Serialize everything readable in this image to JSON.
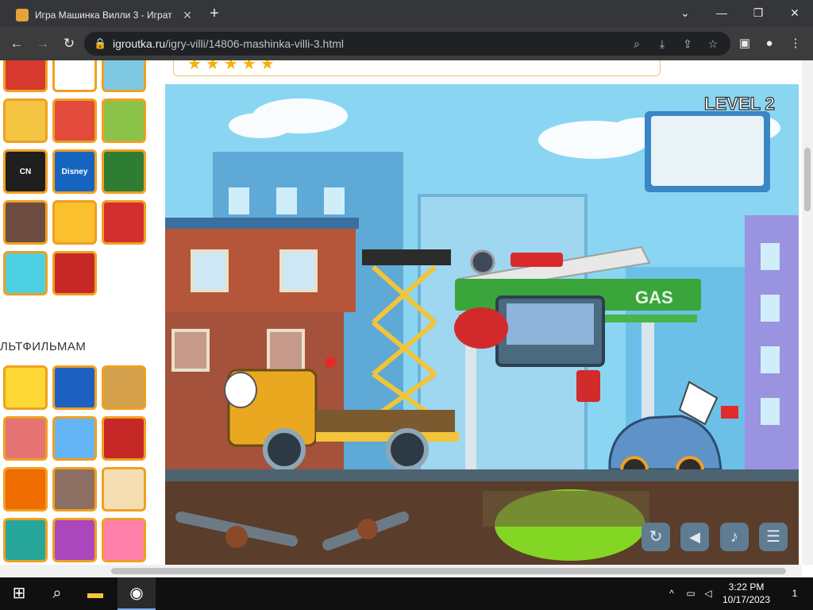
{
  "browser": {
    "tab_title": "Игра Машинка Вилли 3 - Играт",
    "tab_close": "✕",
    "new_tab": "+",
    "url_host": "igroutka.ru",
    "url_path": "/igry-villi/14806-mashinka-villi-3.html"
  },
  "sidebar": {
    "category_title": "ЛЬТФИЛЬМАМ",
    "top_games": [
      {
        "label": "",
        "color": "#d63a2f"
      },
      {
        "label": "",
        "color": "#ffffff"
      },
      {
        "label": "",
        "color": "#7ec8e3"
      },
      {
        "label": "",
        "color": "#f4c542"
      },
      {
        "label": "",
        "color": "#e24a3b"
      },
      {
        "label": "",
        "color": "#8bc34a"
      },
      {
        "label": "CN",
        "color": "#1f1f1f"
      },
      {
        "label": "Disney",
        "color": "#1565c0"
      },
      {
        "label": "",
        "color": "#2e7d32"
      },
      {
        "label": "",
        "color": "#6d4c41"
      },
      {
        "label": "",
        "color": "#fbc02d"
      },
      {
        "label": "",
        "color": "#d32f2f"
      },
      {
        "label": "",
        "color": "#4dd0e1"
      },
      {
        "label": "",
        "color": "#c62828"
      }
    ],
    "cartoon_games": [
      {
        "label": "",
        "color": "#fdd835"
      },
      {
        "label": "",
        "color": "#1e5fc2"
      },
      {
        "label": "",
        "color": "#d4a04c"
      },
      {
        "label": "",
        "color": "#e57373"
      },
      {
        "label": "",
        "color": "#64b5f6"
      },
      {
        "label": "",
        "color": "#c62828"
      },
      {
        "label": "",
        "color": "#ef6c00"
      },
      {
        "label": "",
        "color": "#8d6e63"
      },
      {
        "label": "",
        "color": "#f5deb3"
      },
      {
        "label": "",
        "color": "#26a69a"
      },
      {
        "label": "",
        "color": "#ab47bc"
      },
      {
        "label": "",
        "color": "#ff80ab"
      }
    ]
  },
  "game": {
    "level_text": "LEVEL 2",
    "gas_sign": "GAS"
  },
  "taskbar": {
    "time": "3:22 PM",
    "date": "10/17/2023",
    "notifications": "1"
  }
}
